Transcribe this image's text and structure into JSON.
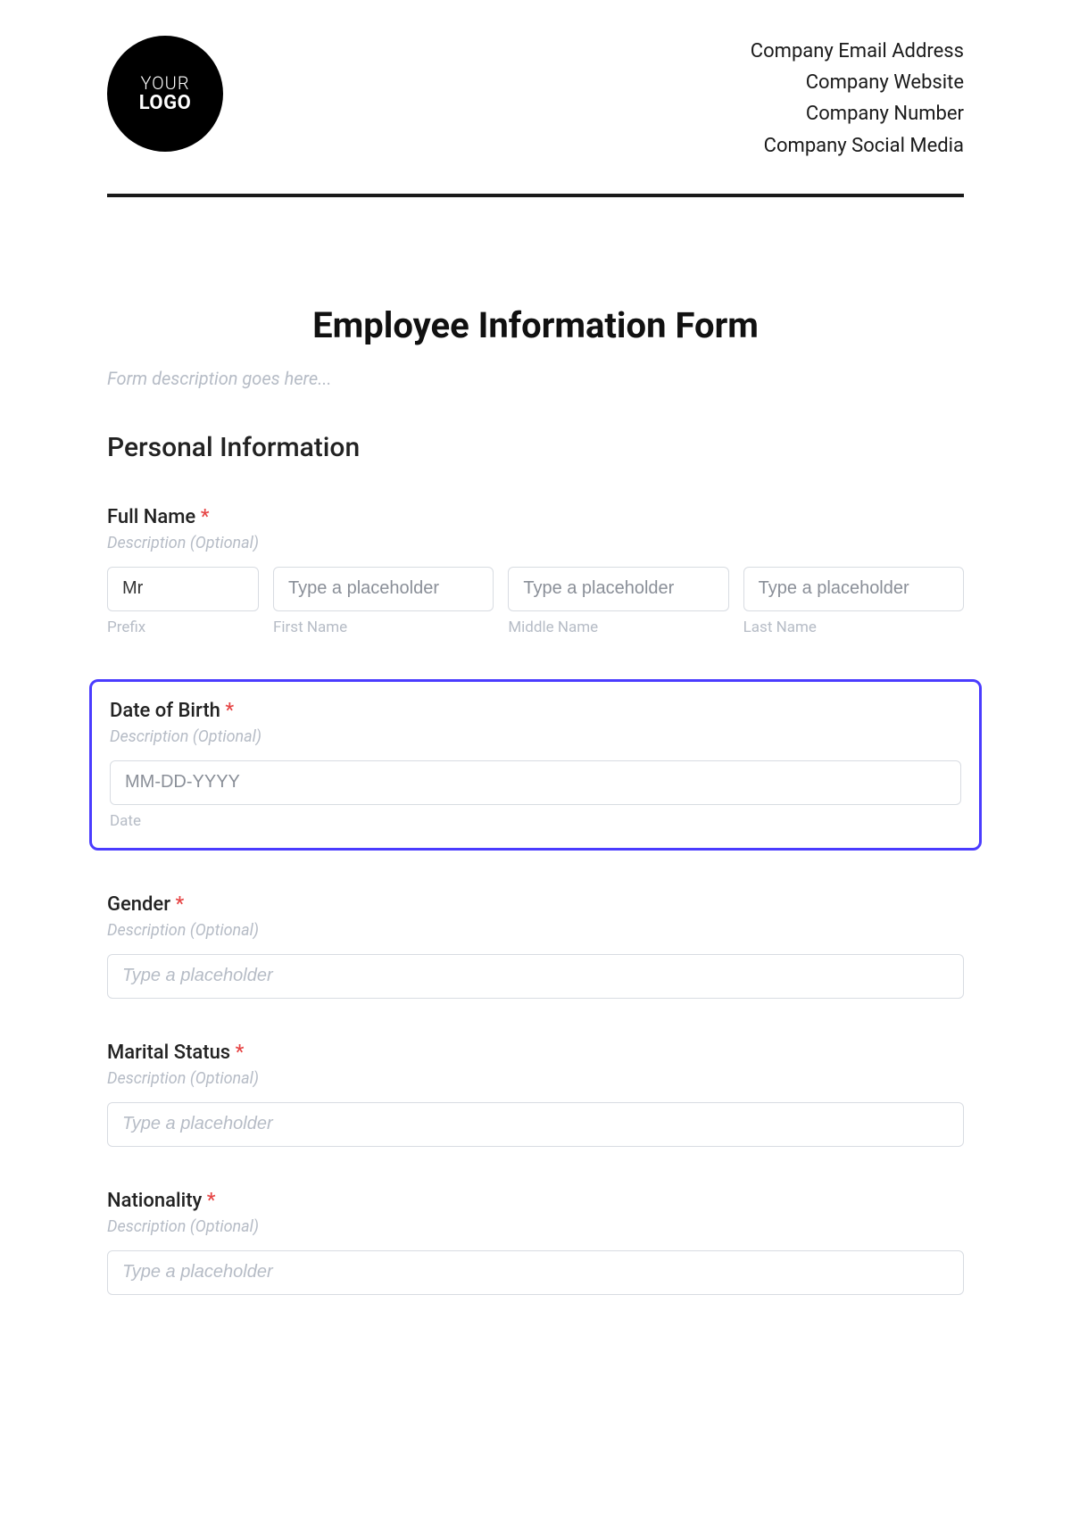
{
  "logo": {
    "line1": "YOUR",
    "line2": "LOGO"
  },
  "company": {
    "email": "Company Email Address",
    "website": "Company Website",
    "number": "Company Number",
    "social": "Company Social Media"
  },
  "form": {
    "title": "Employee Information Form",
    "description_placeholder": "Form description goes here...",
    "section_title": "Personal Information",
    "required_mark": "*",
    "fields": {
      "full_name": {
        "label": "Full Name",
        "description": "Description (Optional)",
        "prefix": {
          "value": "Mr",
          "sublabel": "Prefix"
        },
        "first": {
          "placeholder": "Type a placeholder",
          "sublabel": "First Name"
        },
        "middle": {
          "placeholder": "Type a placeholder",
          "sublabel": "Middle Name"
        },
        "last": {
          "placeholder": "Type a placeholder",
          "sublabel": "Last Name"
        }
      },
      "dob": {
        "label": "Date of Birth",
        "description": "Description (Optional)",
        "placeholder": "MM-DD-YYYY",
        "sublabel": "Date"
      },
      "gender": {
        "label": "Gender",
        "description": "Description (Optional)",
        "placeholder": "Type a placeholder"
      },
      "marital": {
        "label": "Marital Status",
        "description": "Description (Optional)",
        "placeholder": "Type a placeholder"
      },
      "nationality": {
        "label": "Nationality",
        "description": "Description (Optional)",
        "placeholder": "Type a placeholder"
      }
    }
  }
}
